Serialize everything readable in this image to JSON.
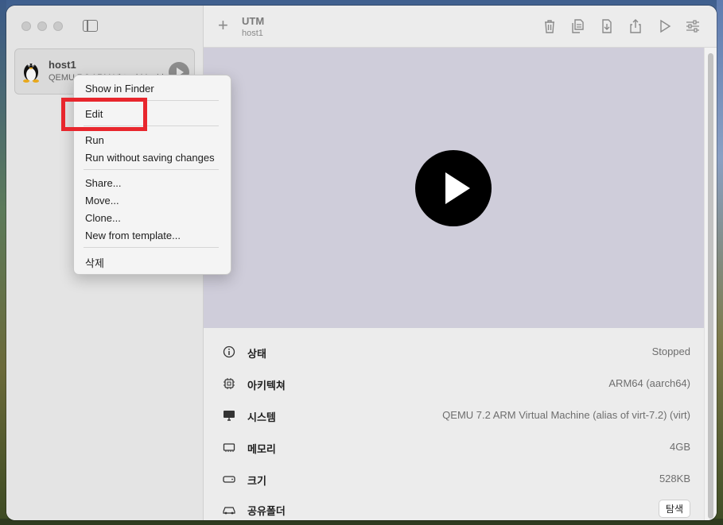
{
  "toolbar": {
    "title": "UTM",
    "subtitle": "host1"
  },
  "vm_list": [
    {
      "name": "host1",
      "subtitle": "QEMU 7.2 ARM Virtual Machine"
    }
  ],
  "context_menu": {
    "items": [
      "Show in Finder",
      "Edit",
      "Run",
      "Run without saving changes",
      "Share...",
      "Move...",
      "Clone...",
      "New from template...",
      "삭제"
    ]
  },
  "details": [
    {
      "label": "상태",
      "value": "Stopped",
      "icon": "info-icon"
    },
    {
      "label": "아키텍쳐",
      "value": "ARM64 (aarch64)",
      "icon": "cpu-icon"
    },
    {
      "label": "시스템",
      "value": "QEMU 7.2 ARM Virtual Machine (alias of virt-7.2) (virt)",
      "icon": "display-icon"
    },
    {
      "label": "메모리",
      "value": "4GB",
      "icon": "memory-icon"
    },
    {
      "label": "크기",
      "value": "528KB",
      "icon": "drive-icon"
    },
    {
      "label": "공유폴더",
      "value": "",
      "button": "탐색",
      "icon": "shared-folder-icon"
    }
  ],
  "colors": {
    "highlight": "#e8262d",
    "preview_bg": "#cfcdda"
  }
}
